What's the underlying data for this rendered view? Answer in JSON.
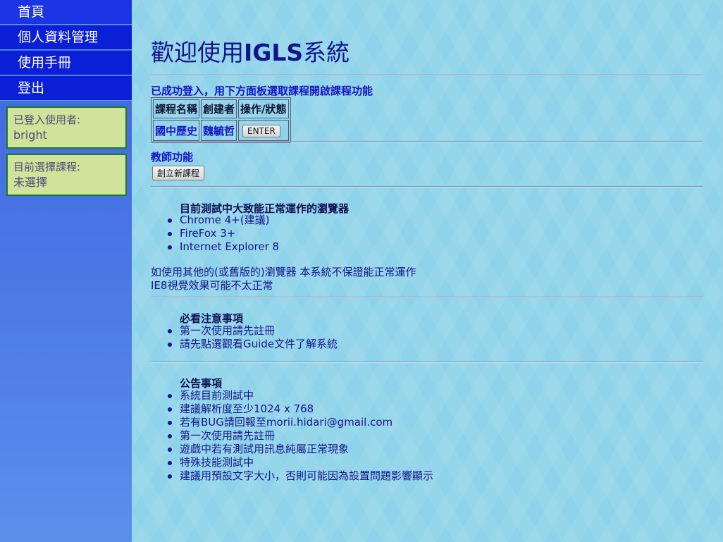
{
  "sidebar": {
    "nav": [
      "首頁",
      "個人資料管理",
      "使用手冊",
      "登出"
    ],
    "user_box": {
      "label": "已登入使用者:",
      "value": "bright"
    },
    "course_box": {
      "label": "目前選擇課程:",
      "value": "未選擇"
    }
  },
  "main": {
    "title_prefix": "歡迎使用",
    "title_brand": "IGLS",
    "title_suffix": "系統",
    "login_msg": "已成功登入，用下方面板選取課程開啟課程功能",
    "course_table": {
      "headers": [
        "課程名稱",
        "創建者",
        "操作/狀態"
      ],
      "rows": [
        {
          "name": "國中歷史",
          "creator": "魏毓哲",
          "action": "ENTER"
        }
      ]
    },
    "teacher": {
      "title": "教師功能",
      "create_button": "創立新課程"
    },
    "browsers": {
      "title": "目前測試中大致能正常運作的瀏覽器",
      "items": [
        "Chrome 4+(建議)",
        "FireFox 3+",
        "Internet Explorer 8"
      ],
      "note1": "如使用其他的(或舊版的)瀏覽器 本系統不保證能正常運作",
      "note2": "IE8視覺效果可能不太正常"
    },
    "notice": {
      "title": "必看注意事項",
      "items": [
        "第一次使用請先註冊",
        "請先點選觀看Guide文件了解系統"
      ]
    },
    "announcements": {
      "title": "公告事項",
      "items": [
        "系統目前測試中",
        "建議解析度至少1024 x 768",
        "若有BUG請回報至morii.hidari@gmail.com",
        "第一次使用請先註冊",
        "遊戲中若有測試用訊息純屬正常現象",
        "特殊技能測試中",
        "建議用預設文字大小，否則可能因為設置問題影響顯示"
      ]
    }
  },
  "colors": {
    "nav_bg": "#0b1fd6",
    "sidebar_bg": "#4a78e6",
    "main_bg": "#8fd3ea",
    "info_box_bg": "#cfe39a",
    "info_box_border": "#1f7a1f",
    "text_dark_blue": "#14148a",
    "link_blue": "#1414c8"
  }
}
